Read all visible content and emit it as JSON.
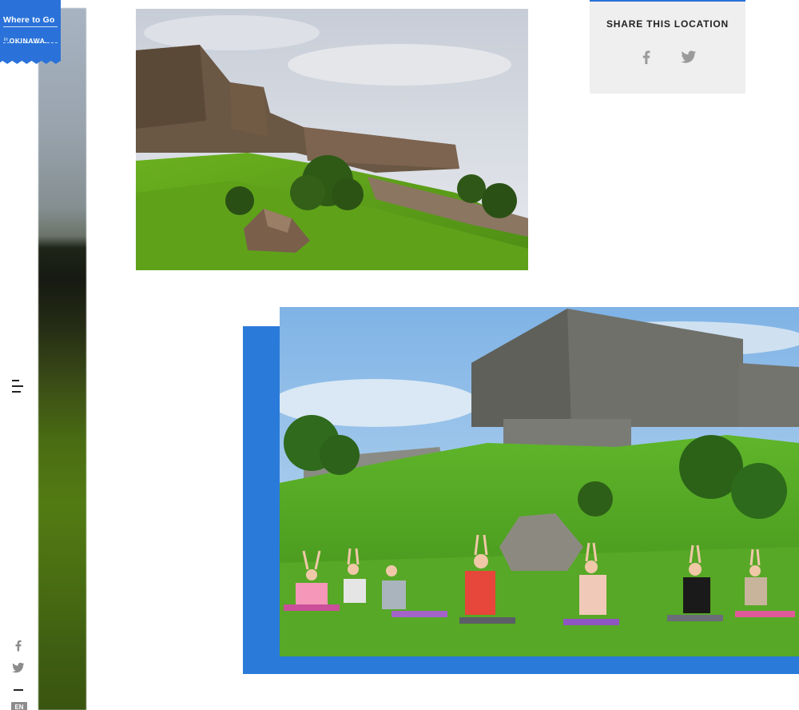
{
  "logo": {
    "title": "Where to Go",
    "prefix": "in",
    "place": "OKINAWA."
  },
  "share": {
    "title": "SHARE THIS LOCATION",
    "facebook_icon": "facebook-icon",
    "twitter_icon": "twitter-icon"
  },
  "rail": {
    "menu_icon": "hamburger-menu-icon",
    "facebook_icon": "facebook-icon",
    "twitter_icon": "twitter-icon",
    "language": "EN"
  },
  "colors": {
    "accent": "#2a72d9",
    "frame": "#2a7ad9",
    "share_bg": "#efefef",
    "icon_gray": "#8c8c8c"
  }
}
